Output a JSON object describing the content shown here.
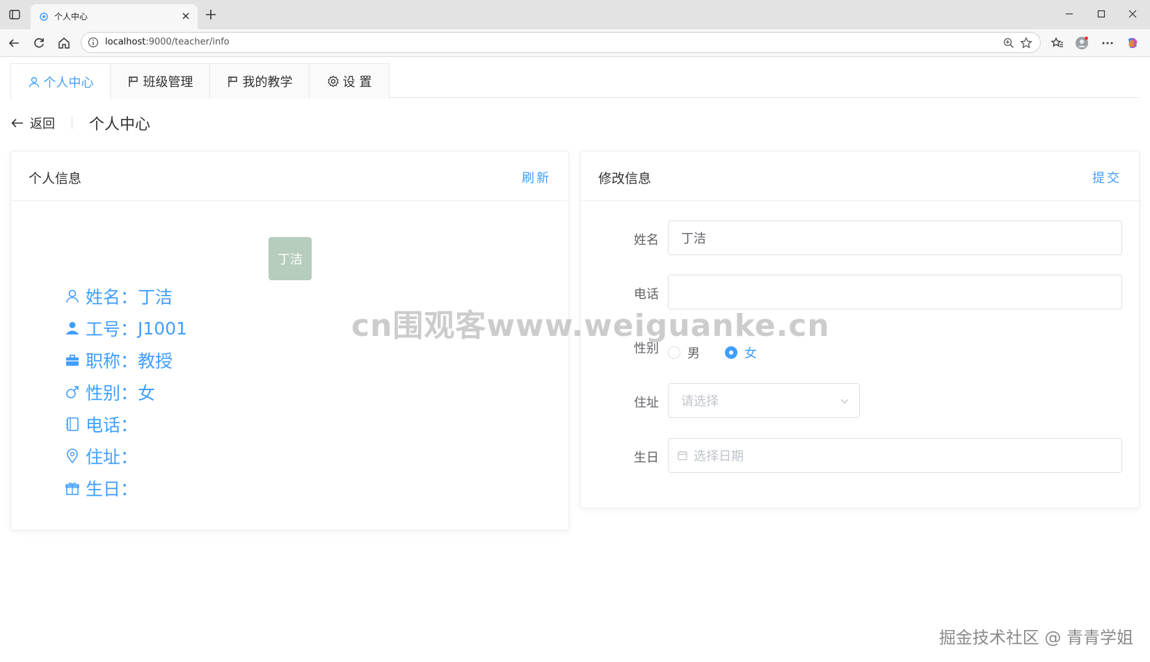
{
  "browser": {
    "tab_title": "个人中心",
    "url_host": "localhost",
    "url_path": ":9000/teacher/info"
  },
  "nav": {
    "tabs": [
      {
        "label": "个人中心",
        "icon": "user-icon",
        "active": true
      },
      {
        "label": "班级管理",
        "icon": "flag-icon",
        "active": false
      },
      {
        "label": "我的教学",
        "icon": "flag-icon",
        "active": false
      },
      {
        "label": "设 置",
        "icon": "gear-icon",
        "active": false
      }
    ]
  },
  "header": {
    "back_label": "返回",
    "title": "个人中心"
  },
  "profile": {
    "title": "个人信息",
    "refresh_label": "刷新",
    "avatar_text": "丁洁",
    "fields": [
      {
        "label": "姓名：",
        "value": "丁洁",
        "icon": "user-icon"
      },
      {
        "label": "工号：",
        "value": "J1001",
        "icon": "user-solid-icon"
      },
      {
        "label": "职称：",
        "value": "教授",
        "icon": "briefcase-icon"
      },
      {
        "label": "性别：",
        "value": "女",
        "icon": "male-icon"
      },
      {
        "label": "电话：",
        "value": "",
        "icon": "notebook-icon"
      },
      {
        "label": "住址：",
        "value": "",
        "icon": "location-icon"
      },
      {
        "label": "生日：",
        "value": "",
        "icon": "present-icon"
      }
    ]
  },
  "edit": {
    "title": "修改信息",
    "submit_label": "提交",
    "name_label": "姓名",
    "name_value": "丁洁",
    "phone_label": "电话",
    "phone_value": "",
    "gender_label": "性别",
    "gender_options": [
      "男",
      "女"
    ],
    "gender_selected": "女",
    "address_label": "住址",
    "address_placeholder": "请选择",
    "birthday_label": "生日",
    "birthday_placeholder": "选择日期"
  },
  "overlay": {
    "watermark": "cn围观客www.weiguanke.cn",
    "credit": "掘金技术社区 @ 青青学姐"
  },
  "colors": {
    "accent": "#409eff",
    "avatar_bg": "#b6ccbc",
    "border": "#ebeef5"
  }
}
